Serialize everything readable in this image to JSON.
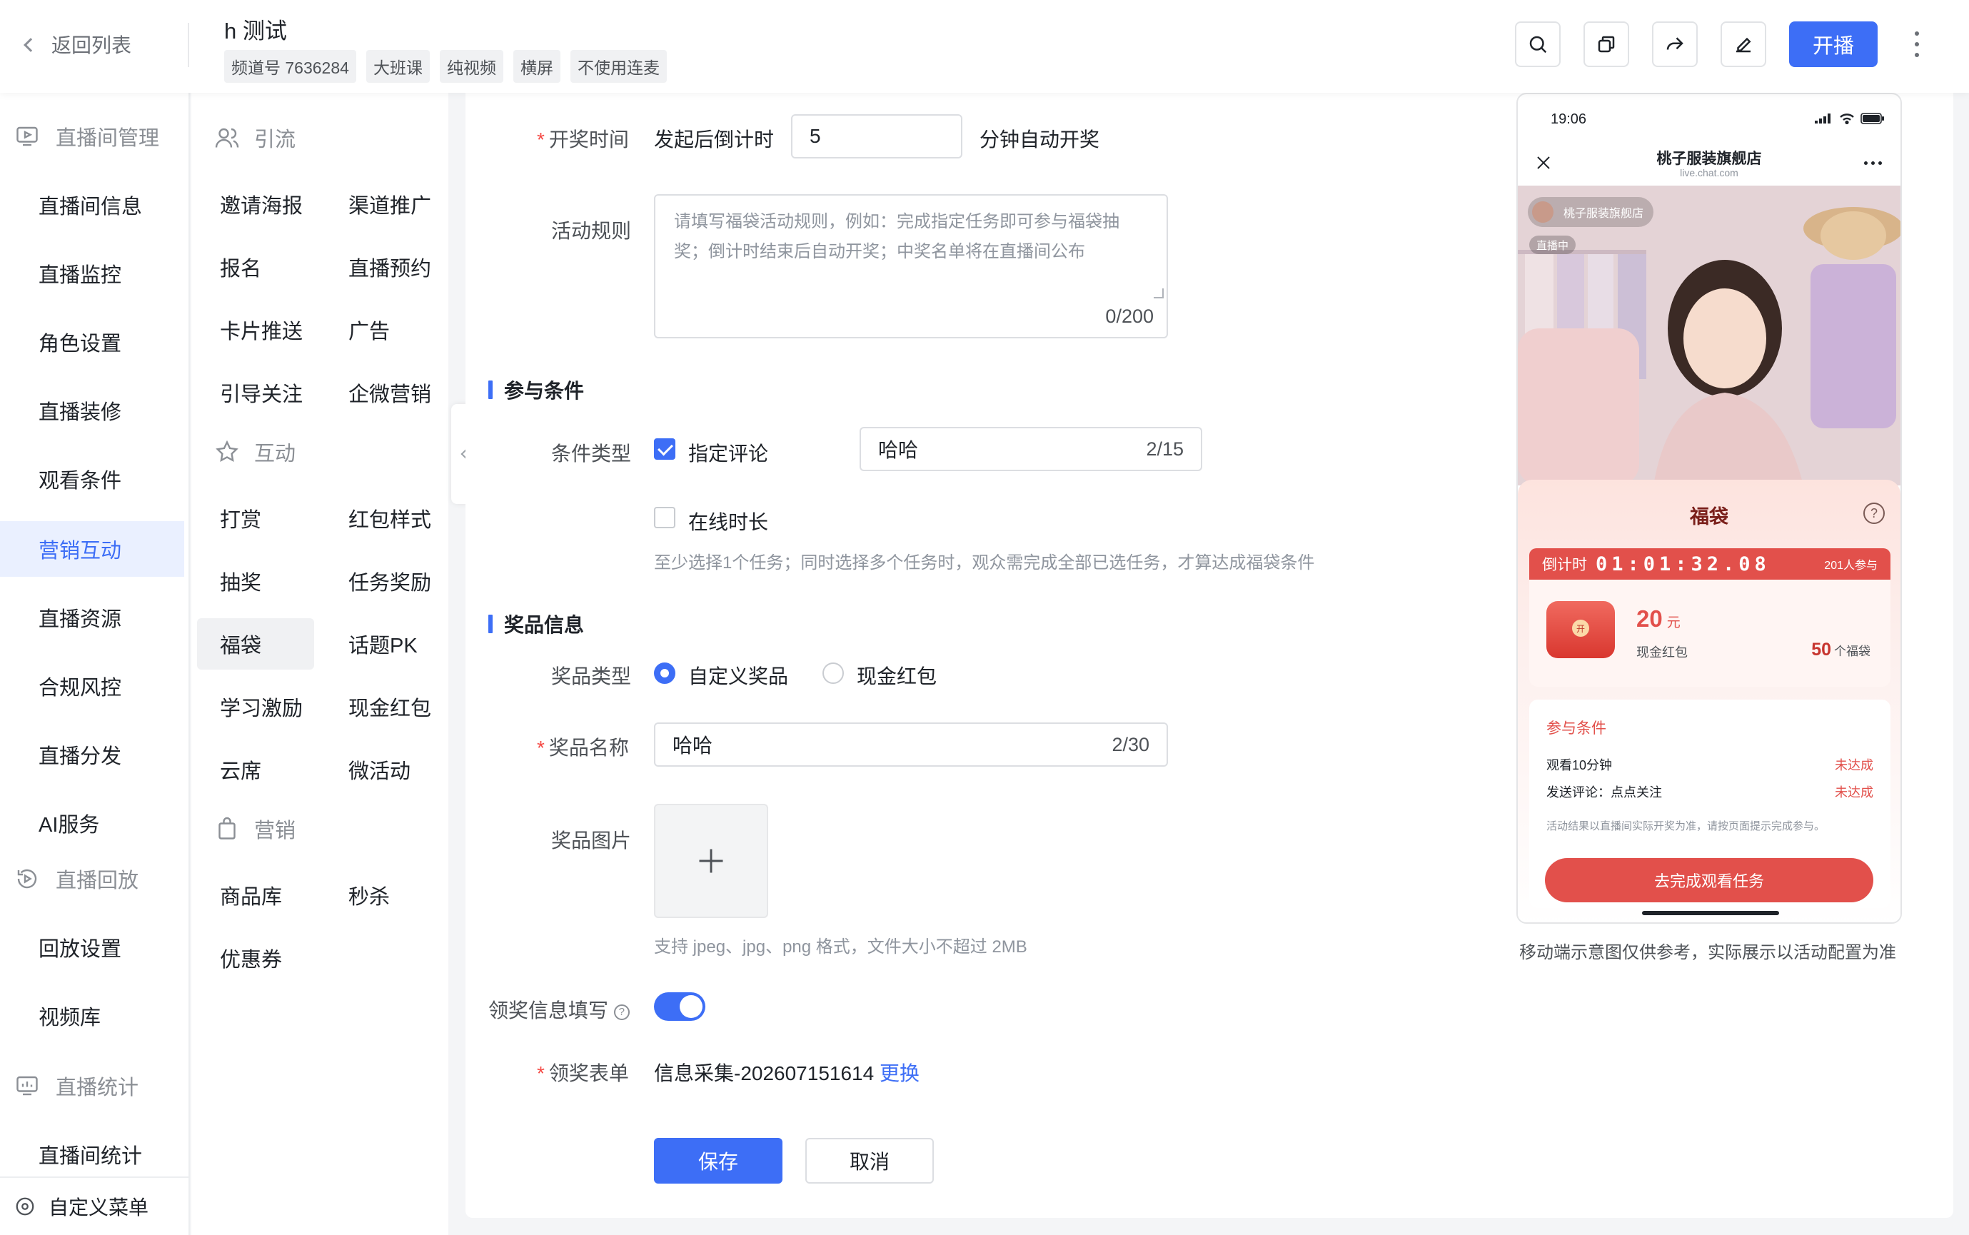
{
  "header": {
    "back_label": "返回列表",
    "title": "h 测试",
    "tags": [
      "频道号 7636284",
      "大班课",
      "纯视频",
      "横屏",
      "不使用连麦"
    ],
    "start_label": "开播",
    "accent_color": "#3d6ef6"
  },
  "sidebar": {
    "groups": [
      {
        "label": "直播间管理",
        "icon": "monitor-play-icon"
      },
      {
        "label": "直播回放",
        "icon": "replay-icon"
      },
      {
        "label": "直播统计",
        "icon": "chart-icon"
      }
    ],
    "items": [
      "直播间信息",
      "直播监控",
      "角色设置",
      "直播装修",
      "观看条件",
      "营销互动",
      "直播资源",
      "合规风控",
      "直播分发",
      "AI服务",
      "回放设置",
      "视频库",
      "直播间统计"
    ],
    "active_item": "营销互动",
    "custom_menu_label": "自定义菜单"
  },
  "submenu": {
    "groups": [
      {
        "label": "引流",
        "icon": "users-icon"
      },
      {
        "label": "互动",
        "icon": "star-icon"
      },
      {
        "label": "营销",
        "icon": "bag-icon"
      }
    ],
    "items": [
      "邀请海报",
      "渠道推广",
      "报名",
      "直播预约",
      "卡片推送",
      "广告",
      "引导关注",
      "企微营销",
      "打赏",
      "红包样式",
      "抽奖",
      "任务奖励",
      "福袋",
      "话题PK",
      "学习激励",
      "现金红包",
      "云席",
      "微活动",
      "商品库",
      "秒杀",
      "优惠券"
    ],
    "active_item": "福袋"
  },
  "form": {
    "draw_time_label": "开奖时间",
    "draw_prefix": "发起后倒计时",
    "draw_minutes": "5",
    "draw_suffix": "分钟自动开奖",
    "rules_label": "活动规则",
    "rules_placeholder": "请填写福袋活动规则，例如：完成指定任务即可参与福袋抽奖；倒计时结束后自动开奖；中奖名单将在直播间公布",
    "rules_count": "0/200",
    "section_conditions": "参与条件",
    "condition_type_label": "条件类型",
    "cond_comment_label": "指定评论",
    "cond_comment_checked": true,
    "cond_comment_value": "哈哈",
    "cond_comment_count": "2/15",
    "cond_online_label": "在线时长",
    "cond_online_checked": false,
    "cond_hint": "至少选择1个任务；同时选择多个任务时，观众需完成全部已选任务，才算达成福袋条件",
    "section_prize": "奖品信息",
    "prize_type_label": "奖品类型",
    "prize_type_options": [
      "自定义奖品",
      "现金红包"
    ],
    "prize_type_selected": "自定义奖品",
    "prize_name_label": "奖品名称",
    "prize_name_value": "哈哈",
    "prize_name_count": "2/30",
    "prize_image_label": "奖品图片",
    "prize_image_hint": "支持 jpeg、jpg、png 格式，文件大小不超过 2MB",
    "claim_info_label": "领奖信息填写",
    "claim_info_enabled": true,
    "claim_form_label": "领奖表单",
    "claim_form_value": "信息采集-202607151614",
    "claim_form_change": "更换",
    "save_label": "保存",
    "cancel_label": "取消"
  },
  "preview": {
    "time": "19:06",
    "shop_name": "桃子服装旗舰店",
    "domain": "live.chat.com",
    "video_chip": "桃子服装旗舰店",
    "live_badge": "直播中",
    "lucky_title": "福袋",
    "countdown_label": "倒计时",
    "countdown_value": "01:01:32.08",
    "participants": "201人参与",
    "prize_amount": "20",
    "prize_unit": "元",
    "prize_name": "现金红包",
    "prize_qty": "50",
    "prize_qty_unit": "个福袋",
    "cond_title": "参与条件",
    "cond_rows": [
      {
        "text": "观看10分钟",
        "status": "未达成"
      },
      {
        "text": "发送评论：点点关注",
        "status": "未达成"
      }
    ],
    "cond_note": "活动结果以直播间实际开奖为准，请按页面提示完成参与。",
    "cond_button": "去完成观看任务",
    "caption": "移动端示意图仅供参考，实际展示以活动配置为准"
  }
}
